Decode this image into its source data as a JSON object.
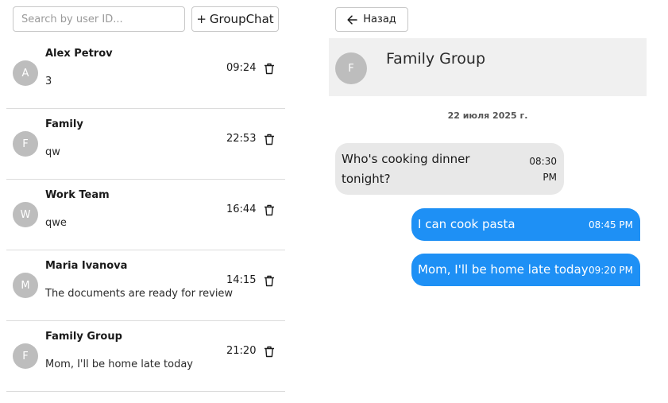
{
  "search": {
    "placeholder": "Search by user ID..."
  },
  "group_button": {
    "plus": "+",
    "label": "GroupChat"
  },
  "chats": [
    {
      "avatar": "A",
      "name": "Alex Petrov",
      "last_message": "3",
      "time": "09:24"
    },
    {
      "avatar": "F",
      "name": "Family",
      "last_message": "qw",
      "time": "22:53"
    },
    {
      "avatar": "W",
      "name": "Work Team",
      "last_message": "qwe",
      "time": "16:44"
    },
    {
      "avatar": "M",
      "name": "Maria Ivanova",
      "last_message": "The documents are ready for review",
      "time": "14:15"
    },
    {
      "avatar": "F",
      "name": "Family Group",
      "last_message": "Mom, I'll be home late today",
      "time": "21:20"
    }
  ],
  "back_button": {
    "label": "Назад"
  },
  "conversation": {
    "avatar": "F",
    "title": "Family Group",
    "date": "22 июля 2025 г.",
    "messages": [
      {
        "direction": "incoming",
        "text": "Who's cooking dinner tonight?",
        "time": "08:30 PM"
      },
      {
        "direction": "outgoing",
        "text": "I can cook pasta",
        "time": "08:45 PM"
      },
      {
        "direction": "outgoing",
        "text": "Mom, I'll be home late today",
        "time": "09:20 PM"
      }
    ]
  },
  "colors": {
    "accent": "#1e90f5",
    "avatar_bg": "#bdbdbd",
    "incoming_bubble": "#e8e8e8",
    "header_bg": "#f0f0f0"
  },
  "icons": {
    "delete": "trash-icon",
    "back": "arrow-left-icon"
  }
}
